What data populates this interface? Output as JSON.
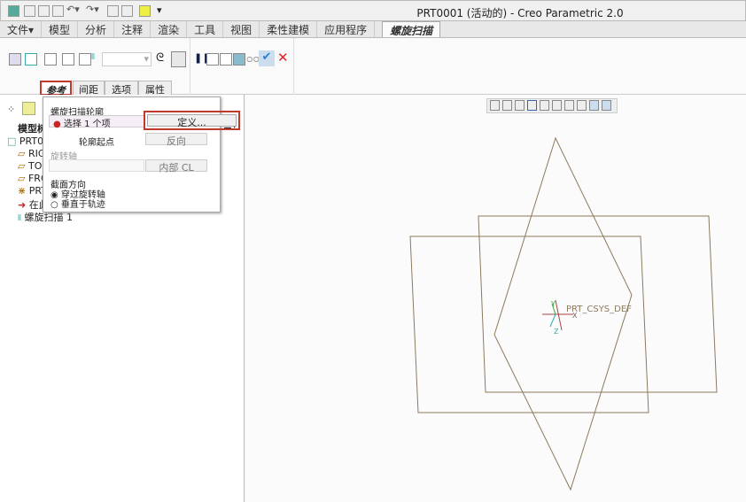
{
  "window": {
    "title": "PRT0001 (活动的) - Creo Parametric 2.0"
  },
  "ribbon_tabs": [
    "文件▾",
    "模型",
    "分析",
    "注释",
    "渲染",
    "工具",
    "视图",
    "柔性建模",
    "应用程序",
    "螺旋扫描"
  ],
  "dashboard_tabs": [
    "参考",
    "间距",
    "选项",
    "属性"
  ],
  "popup": {
    "profile_label": "螺旋扫描轮廓",
    "profile_value": "选择 1 个项",
    "define_button": "定义...",
    "start_point_label": "轮廓起点",
    "flip_button": "反向",
    "axis_label": "旋转轴",
    "internal_cl_button": "内部 CL",
    "section_orientation_label": "截面方向",
    "options": [
      {
        "label": "穿过旋转轴",
        "selected": true
      },
      {
        "label": "垂直于轨迹",
        "selected": false
      }
    ]
  },
  "model_tree": {
    "header": "模型树",
    "items": [
      "PRT0001.PRT",
      "RIGHT",
      "TOP",
      "FRONT",
      "PRT_CSYS_DEF",
      "在此插入",
      "螺旋扫描 1"
    ]
  },
  "graphics": {
    "csys_label": "PRT_CSYS_DEF",
    "axis_x": "X",
    "axis_y": "Y",
    "axis_z": "Z",
    "plane_color": "#8b7a5e"
  },
  "colors": {
    "highlight": "#c0392b",
    "confirm": "#2a7fd4",
    "cancel": "#d22"
  }
}
